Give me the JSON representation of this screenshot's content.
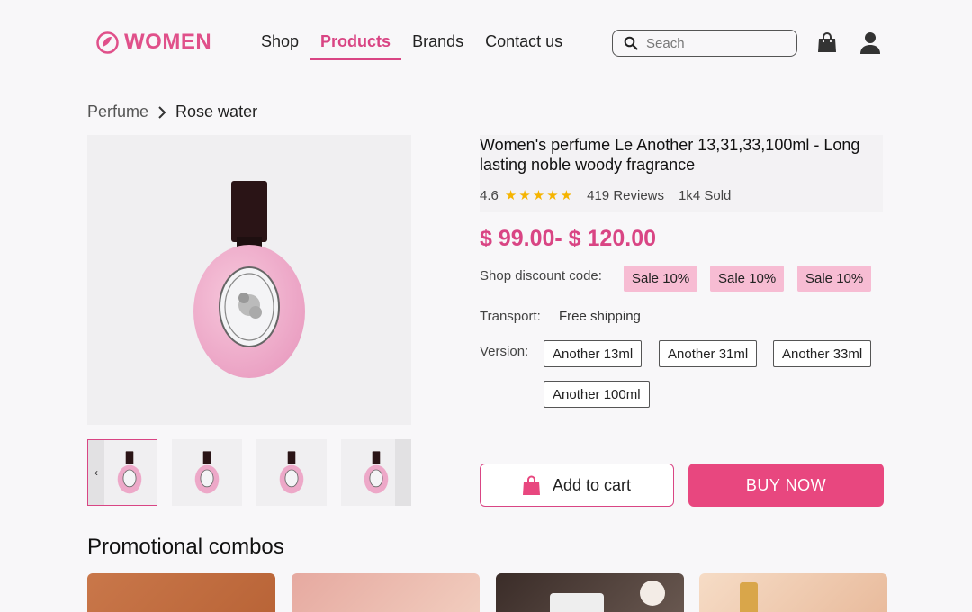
{
  "brand": {
    "name": "WOMEN",
    "color": "#e0508a"
  },
  "nav": {
    "items": [
      "Shop",
      "Products",
      "Brands",
      "Contact us"
    ],
    "active": "Products"
  },
  "search": {
    "placeholder": "Seach",
    "value": ""
  },
  "icons": {
    "search": "search-icon",
    "bag": "shopping-bag-icon",
    "user": "user-icon"
  },
  "breadcrumb": {
    "parent": "Perfume",
    "current": "Rose water"
  },
  "product": {
    "title": "Women's perfume Le Another 13,31,33,100ml - Long lasting noble woody fragrance",
    "rating": "4.6",
    "stars": 5,
    "reviews": "419 Reviews",
    "sold": "1k4 Sold",
    "price": "$ 99.00- $ 120.00",
    "discount_label": "Shop discount code:",
    "discount_codes": [
      "Sale 10%",
      "Sale 10%",
      "Sale 10%"
    ],
    "transport_label": "Transport:",
    "transport_value": "Free shipping",
    "version_label": "Version:",
    "versions": [
      "Another 13ml",
      "Another 31ml",
      "Another 33ml",
      "Another 100ml"
    ]
  },
  "actions": {
    "add_to_cart": "Add to cart",
    "buy_now": "BUY NOW"
  },
  "promo": {
    "title": "Promotional combos"
  },
  "colors": {
    "accent": "#d94584",
    "chip": "#f7bcd3",
    "buy": "#e8477f"
  }
}
